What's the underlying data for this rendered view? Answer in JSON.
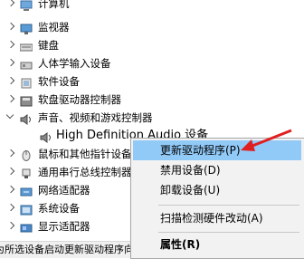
{
  "tree": [
    {
      "label": "计算机",
      "icon": "computer-icon",
      "indent": 0,
      "expanded": false
    },
    {
      "label": "监视器",
      "icon": "monitor-icon",
      "indent": 0,
      "expanded": false
    },
    {
      "label": "键盘",
      "icon": "keyboard-icon",
      "indent": 0,
      "expanded": false
    },
    {
      "label": "人体学输入设备",
      "icon": "hid-icon",
      "indent": 0,
      "expanded": false
    },
    {
      "label": "软件设备",
      "icon": "software-device-icon",
      "indent": 0,
      "expanded": false
    },
    {
      "label": "软盘驱动器控制器",
      "icon": "floppy-controller-icon",
      "indent": 0,
      "expanded": false
    },
    {
      "label": "声音、视频和游戏控制器",
      "icon": "speaker-icon",
      "indent": 0,
      "expanded": true
    },
    {
      "label": "High Definition Audio 设备",
      "icon": "speaker-icon",
      "indent": 1,
      "expanded": null
    },
    {
      "label": "鼠标和其他指针设备",
      "icon": "mouse-icon",
      "indent": 0,
      "expanded": false
    },
    {
      "label": "通用串行总线控制器",
      "icon": "usb-icon",
      "indent": 0,
      "expanded": false
    },
    {
      "label": "网络适配器",
      "icon": "network-adapter-icon",
      "indent": 0,
      "expanded": false
    },
    {
      "label": "系统设备",
      "icon": "system-device-icon",
      "indent": 0,
      "expanded": false
    },
    {
      "label": "显示适配器",
      "icon": "display-adapter-icon",
      "indent": 0,
      "expanded": false
    }
  ],
  "context_menu": {
    "items": [
      {
        "label": "更新驱动程序(P)",
        "highlighted": true,
        "bold": false
      },
      {
        "label": "禁用设备(D)",
        "highlighted": false,
        "bold": false
      },
      {
        "label": "卸载设备(U)",
        "highlighted": false,
        "bold": false
      },
      {
        "label": "扫描检测硬件改动(A)",
        "highlighted": false,
        "bold": false
      },
      {
        "label": "属性(R)",
        "highlighted": false,
        "bold": true
      }
    ]
  },
  "status_bar": {
    "text": "为所选设备启动更新驱动程序向导。"
  },
  "colors": {
    "highlight": "#91c9f7",
    "arrow": "#e02020",
    "menu_bg": "#f2f2f2"
  }
}
